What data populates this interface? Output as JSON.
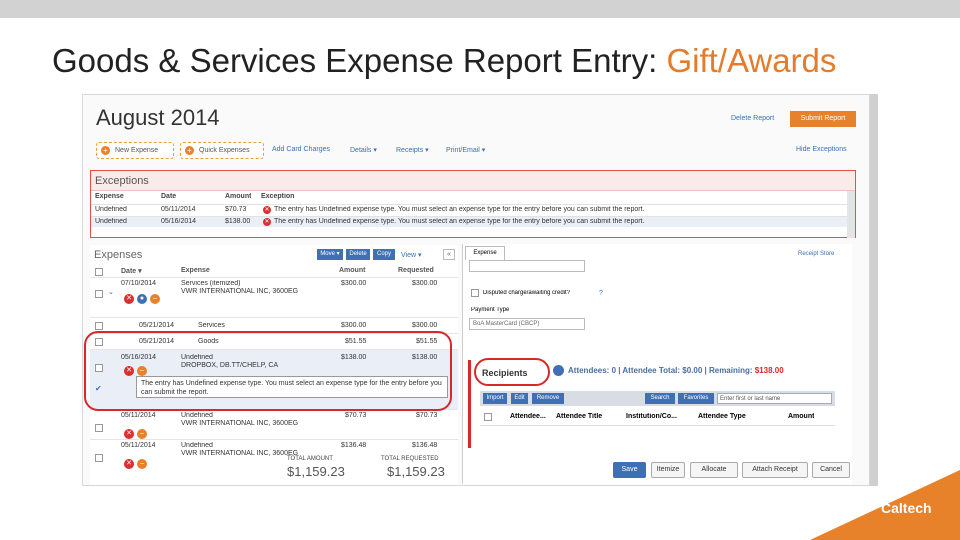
{
  "slide": {
    "title_main": "Goods & Services Expense Report Entry: ",
    "title_highlight": "Gift/Awards"
  },
  "report": {
    "month": "August 2014",
    "delete_report": "Delete Report",
    "submit_report": "Submit Report"
  },
  "toolbar": {
    "new_expense": "New Expense",
    "quick_expenses": "Quick Expenses",
    "add_card_charges": "Add Card Charges",
    "details": "Details ▾",
    "receipts": "Receipts ▾",
    "print_email": "Print/Email ▾",
    "hide_exceptions": "Hide Exceptions"
  },
  "exceptions": {
    "title": "Exceptions",
    "columns": [
      "Expense",
      "Date",
      "Amount",
      "Exception"
    ],
    "rows": [
      {
        "expense": "Undefined",
        "date": "05/11/2014",
        "amount": "$70.73",
        "text": "The entry has Undefined expense type. You must select an expense type for the entry before you can submit the report."
      },
      {
        "expense": "Undefined",
        "date": "05/16/2014",
        "amount": "$138.00",
        "text": "The entry has Undefined expense type. You must select an expense type for the entry before you can submit the report."
      }
    ]
  },
  "expenses": {
    "title": "Expenses",
    "move": "Move ▾",
    "delete": "Delete",
    "copy": "Copy",
    "view": "View ▾",
    "collapse": "«",
    "columns": {
      "date": "Date ▾",
      "expense": "Expense",
      "amount": "Amount",
      "requested": "Requested"
    },
    "rows": [
      {
        "date": "07/10/2014",
        "type": "Services (itemized)",
        "vendor": "VWR INTERNATIONAL INC, 3600EG",
        "amount": "$300.00",
        "requested": "$300.00"
      },
      {
        "date": "05/21/2014",
        "type": "Services",
        "vendor": "",
        "amount": "$300.00",
        "requested": "$300.00"
      },
      {
        "date": "05/21/2014",
        "type": "Goods",
        "vendor": "",
        "amount": "$51.55",
        "requested": "$51.55"
      },
      {
        "date": "05/16/2014",
        "type": "Undefined",
        "vendor": "DROPBOX, DB.TT/CHELP, CA",
        "amount": "$138.00",
        "requested": "$138.00"
      },
      {
        "date": "05/11/2014",
        "type": "Undefined",
        "vendor": "VWR INTERNATIONAL INC, 3600EG",
        "amount": "$70.73",
        "requested": "$70.73"
      },
      {
        "date": "05/11/2014",
        "type": "Undefined",
        "vendor": "VWR INTERNATIONAL INC, 3600EG",
        "amount": "$136.48",
        "requested": "$136.48"
      }
    ],
    "tooltip": "The entry has Undefined expense type. You must select an expense type for the entry before you can submit the report.",
    "total_amount_label": "TOTAL AMOUNT",
    "total_amount": "$1,159.23",
    "total_requested_label": "TOTAL REQUESTED",
    "total_requested": "$1,159.23"
  },
  "detail": {
    "tab": "Expense",
    "receipt_store": "Receipt Store",
    "disputed": "Disputed charge/awaiting credit?",
    "payment_type_label": "Payment Type",
    "payment_type": "BoA MasterCard (CBCP)",
    "recipients": "Recipients",
    "attendees": "Attendees: 0",
    "attendee_total": "Attendee Total: $0.00",
    "remaining_label": "Remaining: ",
    "remaining": "$138.00",
    "att_buttons": {
      "import": "Import",
      "edit": "Edit",
      "remove": "Remove",
      "search": "Search",
      "favorites": "Favorites"
    },
    "search_placeholder": "Enter first or last name",
    "att_columns": [
      "Attendee...",
      "Attendee Title",
      "Institution/Co...",
      "Attendee Type",
      "Amount"
    ],
    "footer": {
      "save": "Save",
      "itemize": "Itemize",
      "allocate": "Allocate",
      "attach_receipt": "Attach Receipt",
      "cancel": "Cancel"
    }
  },
  "brand": {
    "name": "Caltech"
  }
}
